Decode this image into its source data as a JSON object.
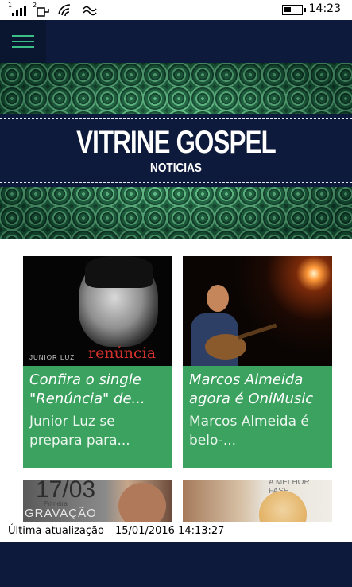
{
  "status_bar": {
    "time": "14:23",
    "sim1": "1",
    "sim2": "2",
    "icons": [
      "signal-icon",
      "signal-icon",
      "wifi-icon",
      "data-sync-icon",
      "battery-icon"
    ]
  },
  "app_bar": {
    "menu_icon": "hamburger-menu-icon"
  },
  "banner": {
    "title": "VITRINE GOSPEL",
    "subtitle": "NOTICIAS"
  },
  "colors": {
    "navy": "#0d1a3b",
    "card_green": "#3ca25f",
    "menu_accent": "#3bbf86"
  },
  "news": [
    {
      "title": "Confira o single \"Renúncia\" de...",
      "summary": "Junior Luz se prepara para...",
      "image_caption_small": "JUNIOR LUZ",
      "image_caption_big": "renúncia"
    },
    {
      "title": "Marcos Almeida agora é OniMusic",
      "summary": "Marcos Almeida é belo-..."
    },
    {
      "image_text_big": "17/03",
      "image_text_small": "Primeira",
      "image_text_mid": "GRAVAÇÃO"
    },
    {
      "image_text_small": "A MELHOR FASE"
    }
  ],
  "footer": {
    "update_label": "Última atualização",
    "update_value": "15/01/2016 14:13:27"
  }
}
